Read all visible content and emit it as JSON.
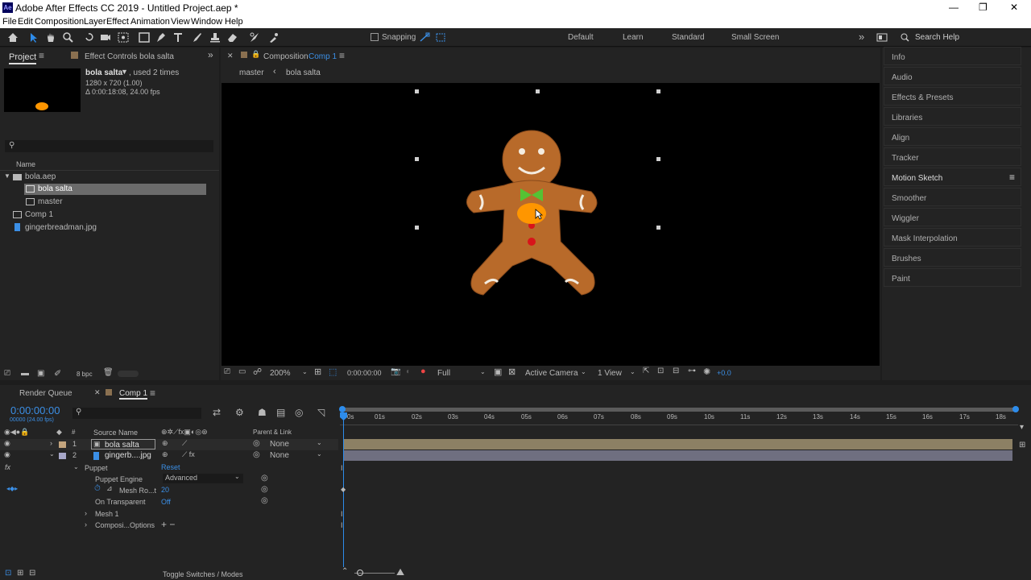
{
  "window": {
    "title": "Adobe After Effects CC 2019 - Untitled Project.aep *",
    "min": "—",
    "max": "❐",
    "close": "✕"
  },
  "menu": [
    "File",
    "Edit",
    "Composition",
    "Layer",
    "Effect",
    "Animation",
    "View",
    "Window",
    "Help"
  ],
  "toolbar": {
    "snapping": "Snapping",
    "workspaces": [
      "Default",
      "Learn",
      "Standard",
      "Small Screen"
    ],
    "search_placeholder": "Search Help",
    "more": "»"
  },
  "project": {
    "tab": "Project",
    "tab2": "Effect Controls bola salta",
    "item_name": "bola salta",
    "item_used": ", used 2 times",
    "item_dims": "1280 x 720 (1.00)",
    "item_dur": "Δ 0:00:18:08, 24.00 fps",
    "col_name": "Name",
    "items": [
      "bola.aep",
      "bola salta",
      "master",
      "Comp 1",
      "gingerbreadman.jpg"
    ],
    "bpc": "8 bpc"
  },
  "comp": {
    "tab_prefix": "Composition",
    "tab_name": "Comp 1",
    "crumb1": "master",
    "crumb2": "bola salta",
    "zoom": "200%",
    "time": "0:00:00:00",
    "res": "Full",
    "camera": "Active Camera",
    "view": "1 View",
    "exposure": "+0.0"
  },
  "right_panels": [
    "Info",
    "Audio",
    "Effects & Presets",
    "Libraries",
    "Align",
    "Tracker",
    "Motion Sketch",
    "Smoother",
    "Wiggler",
    "Mask Interpolation",
    "Brushes",
    "Paint"
  ],
  "timeline": {
    "tab_rq": "Render Queue",
    "tab_comp": "Comp 1",
    "timecode": "0:00:00:00",
    "fps": "00000 (24.00 fps)",
    "col_source": "Source Name",
    "col_parent": "Parent & Link",
    "col_num": "#",
    "layers": [
      {
        "num": "1",
        "name": "bola salta",
        "parent": "None"
      },
      {
        "num": "2",
        "name": "gingerb....jpg",
        "parent": "None"
      }
    ],
    "props": {
      "puppet": "Puppet",
      "reset": "Reset",
      "engine_lbl": "Puppet Engine",
      "engine_val": "Advanced",
      "mesh_lbl": "Mesh Ro...t",
      "mesh_val": "20",
      "ontrans_lbl": "On Transparent",
      "ontrans_val": "Off",
      "mesh1": "Mesh 1",
      "compopts": "Composi...Options"
    },
    "ruler": [
      "0s",
      "01s",
      "02s",
      "03s",
      "04s",
      "05s",
      "06s",
      "07s",
      "08s",
      "09s",
      "10s",
      "11s",
      "12s",
      "13s",
      "14s",
      "15s",
      "16s",
      "17s",
      "18s"
    ],
    "toggle": "Toggle Switches / Modes"
  },
  "colors": {
    "accent": "#2d8ceb",
    "orange": "#ff9600",
    "layer1": "#8c8064",
    "layer2": "#6f6f80"
  }
}
